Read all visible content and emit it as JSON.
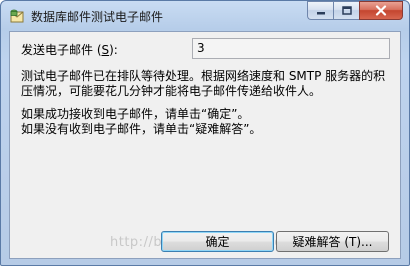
{
  "window": {
    "title": "数据库邮件测试电子邮件",
    "caption_buttons": {
      "minimize": "minimize",
      "maximize": "maximize",
      "close": "close"
    }
  },
  "form": {
    "email_label_prefix": "发送电子邮件 (",
    "email_label_mnemonic": "S",
    "email_label_suffix": "):",
    "email_value": "3"
  },
  "message": {
    "line1": "测试电子邮件已在排队等待处理。根据网络速度和 SMTP 服务器的积",
    "line2": "压情况，可能要花几分钟才能将电子邮件传递给收件人。",
    "line3": "如果成功接收到电子邮件，请单击“确定”。",
    "line4": "如果没有收到电子邮件，请单击“疑难解答”。"
  },
  "buttons": {
    "ok_label": "确定",
    "troubleshoot_label": "疑难解答 (T)..."
  },
  "watermark": "http://blog.csdn.net/qinggan",
  "colors": {
    "title_bar": "#c9dcf3",
    "client_bg": "#f0f0f0",
    "close_button": "#c4452f",
    "default_button_border": "#3c7fb1"
  }
}
